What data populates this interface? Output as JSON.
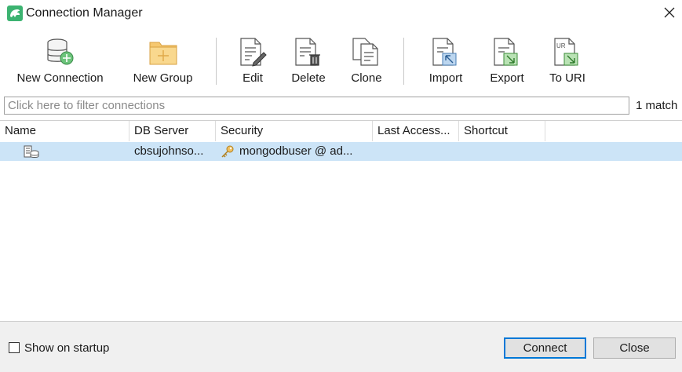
{
  "window": {
    "title": "Connection Manager",
    "accent": "#3cb371"
  },
  "toolbar": {
    "new_connection": "New Connection",
    "new_group": "New Group",
    "edit": "Edit",
    "delete": "Delete",
    "clone": "Clone",
    "import": "Import",
    "export": "Export",
    "to_uri": "To URI"
  },
  "filter": {
    "placeholder": "Click here to filter connections",
    "value": "",
    "match_count": "1 match"
  },
  "table": {
    "columns": [
      "Name",
      "DB Server",
      "Security",
      "Last Access...",
      "Shortcut"
    ],
    "rows": [
      {
        "name": "",
        "db_server": "cbsujohnso...",
        "security": "mongodbuser @ ad...",
        "last_access": "",
        "shortcut": ""
      }
    ],
    "selected_row_color": "#cce4f7"
  },
  "footer": {
    "show_on_startup": "Show on startup",
    "show_on_startup_checked": false,
    "connect": "Connect",
    "close": "Close"
  }
}
